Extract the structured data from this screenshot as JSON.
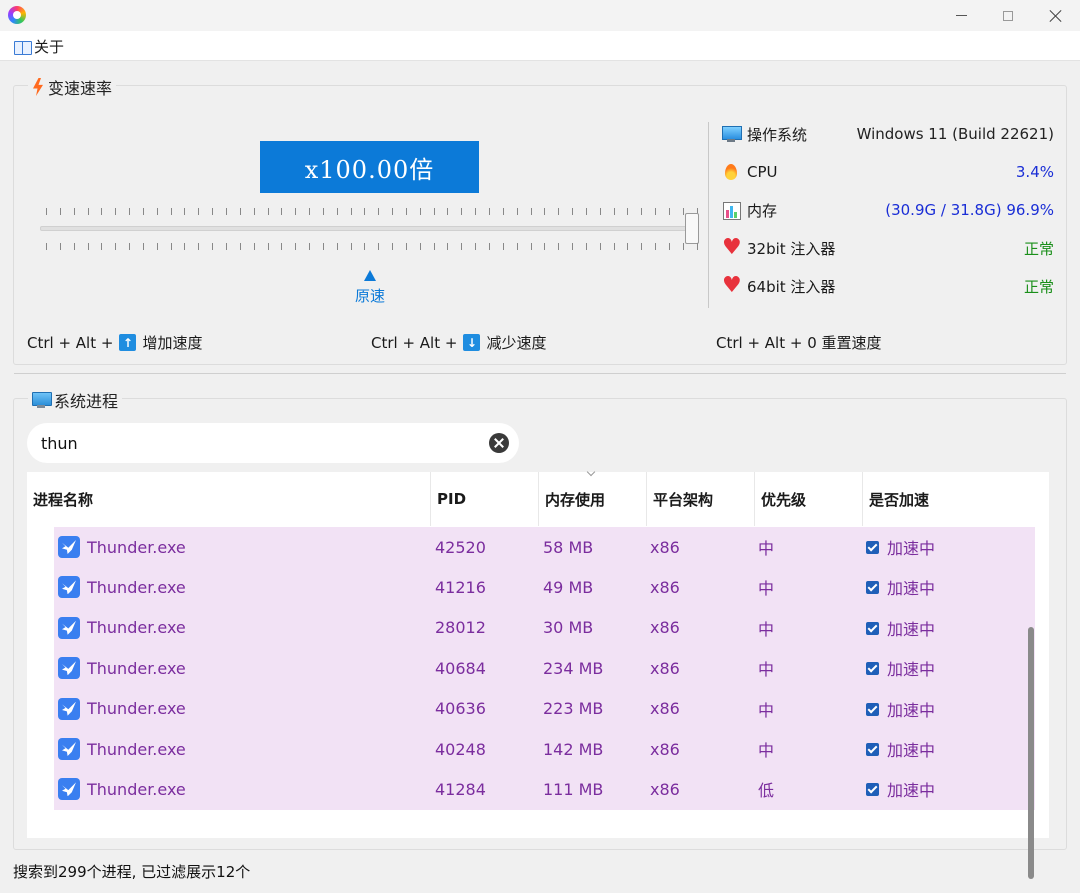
{
  "window": {
    "app_icon": "rainbow-circle-icon"
  },
  "menu": {
    "about_label": "关于",
    "about_icon": "book-icon"
  },
  "speed": {
    "group_title": "变速速率",
    "rate_display": "x100.00倍",
    "slider_value_fraction": 1.0,
    "origin_label": "原速",
    "shortcut_increase_prefix": "Ctrl + Alt +",
    "shortcut_increase_label": "增加速度",
    "shortcut_decrease_prefix": "Ctrl + Alt +",
    "shortcut_decrease_label": "减少速度",
    "shortcut_reset_label": "Ctrl + Alt + 0 重置速度",
    "accent_color": "#0c7ad8"
  },
  "system": {
    "os_label": "操作系统",
    "os_value": "Windows 11 (Build 22621)",
    "cpu_label": "CPU",
    "cpu_value": "3.4%",
    "mem_label": "内存",
    "mem_value": "(30.9G / 31.8G) 96.9%",
    "inj32_label": "32bit 注入器",
    "inj32_value": "正常",
    "inj64_label": "64bit 注入器",
    "inj64_value": "正常"
  },
  "process": {
    "group_title": "系统进程",
    "search_value": "thun",
    "columns": {
      "name": "进程名称",
      "pid": "PID",
      "memory": "内存使用",
      "arch": "平台架构",
      "priority": "优先级",
      "accelerated": "是否加速"
    },
    "rows": [
      {
        "name": "Thunder.exe",
        "pid": "42520",
        "memory": "58 MB",
        "arch": "x86",
        "priority": "中",
        "accelerated": "加速中"
      },
      {
        "name": "Thunder.exe",
        "pid": "41216",
        "memory": "49 MB",
        "arch": "x86",
        "priority": "中",
        "accelerated": "加速中"
      },
      {
        "name": "Thunder.exe",
        "pid": "28012",
        "memory": "30 MB",
        "arch": "x86",
        "priority": "中",
        "accelerated": "加速中"
      },
      {
        "name": "Thunder.exe",
        "pid": "40684",
        "memory": "234 MB",
        "arch": "x86",
        "priority": "中",
        "accelerated": "加速中"
      },
      {
        "name": "Thunder.exe",
        "pid": "40636",
        "memory": "223 MB",
        "arch": "x86",
        "priority": "中",
        "accelerated": "加速中"
      },
      {
        "name": "Thunder.exe",
        "pid": "40248",
        "memory": "142 MB",
        "arch": "x86",
        "priority": "中",
        "accelerated": "加速中"
      },
      {
        "name": "Thunder.exe",
        "pid": "41284",
        "memory": "111 MB",
        "arch": "x86",
        "priority": "低",
        "accelerated": "加速中"
      }
    ],
    "row_highlight_color": "#f2e2f5",
    "row_text_color": "#7b2d9e"
  },
  "status": {
    "text": "搜索到299个进程, 已过滤展示12个"
  }
}
